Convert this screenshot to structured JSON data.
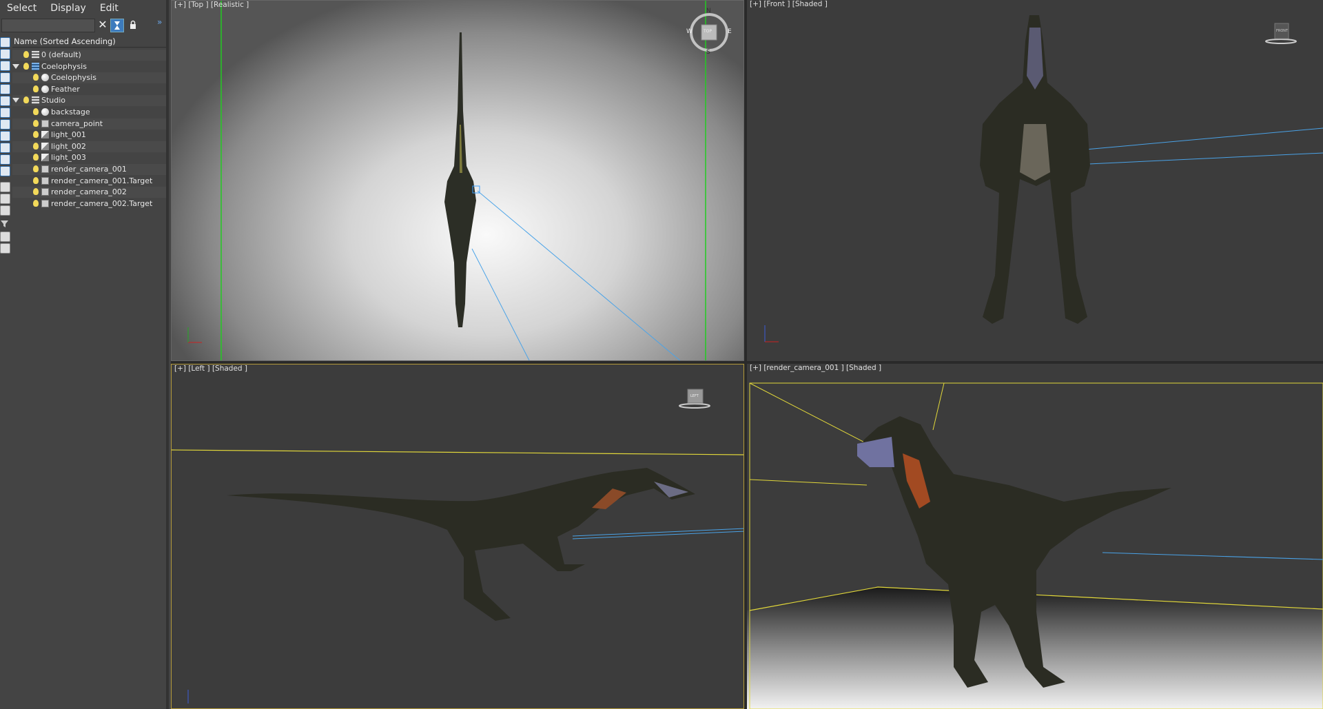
{
  "menu": {
    "items": [
      "Select",
      "Display",
      "Edit"
    ]
  },
  "explorer": {
    "column_header": "Name (Sorted Ascending)",
    "rows": [
      {
        "label": "0 (default)",
        "icon": "layer-icon",
        "indent": 0,
        "expander": false
      },
      {
        "label": "Coelophysis",
        "icon": "layer-icon",
        "indent": 0,
        "expander": true
      },
      {
        "label": "Coelophysis",
        "icon": "sphere-object-icon",
        "indent": 1,
        "expander": false
      },
      {
        "label": "Feather",
        "icon": "sphere-object-icon",
        "indent": 1,
        "expander": false
      },
      {
        "label": "Studio",
        "icon": "layer-icon",
        "indent": 0,
        "expander": true
      },
      {
        "label": "backstage",
        "icon": "sphere-object-icon",
        "indent": 1,
        "expander": false
      },
      {
        "label": "camera_point",
        "icon": "camera-icon",
        "indent": 1,
        "expander": false
      },
      {
        "label": "light_001",
        "icon": "light-icon",
        "indent": 1,
        "expander": false
      },
      {
        "label": "light_002",
        "icon": "light-icon",
        "indent": 1,
        "expander": false
      },
      {
        "label": "light_003",
        "icon": "light-icon",
        "indent": 1,
        "expander": false
      },
      {
        "label": "render_camera_001",
        "icon": "camera-icon",
        "indent": 1,
        "expander": false
      },
      {
        "label": "render_camera_001.Target",
        "icon": "camera-icon",
        "indent": 1,
        "expander": false
      },
      {
        "label": "render_camera_002",
        "icon": "camera-icon",
        "indent": 1,
        "expander": false
      },
      {
        "label": "render_camera_002.Target",
        "icon": "camera-icon",
        "indent": 1,
        "expander": false
      }
    ]
  },
  "viewports": {
    "top": {
      "label": "[+] [Top ] [Realistic ]",
      "compass": {
        "n": "N",
        "s": "S",
        "e": "E",
        "w": "W",
        "cube": "TOP"
      }
    },
    "front": {
      "label": "[+] [Front ] [Shaded ]",
      "cube": "FRONT"
    },
    "left": {
      "label": "[+] [Left ] [Shaded ]",
      "cube": "LEFT"
    },
    "camera": {
      "label": "[+] [render_camera_001 ] [Shaded ]"
    }
  },
  "colors": {
    "accent": "#3d7bbd",
    "viewport_bg": "#3c3c3c",
    "grid_green": "#22cc22",
    "selection_yellow": "#e2d83a",
    "camera_line": "#4aa3e8"
  }
}
